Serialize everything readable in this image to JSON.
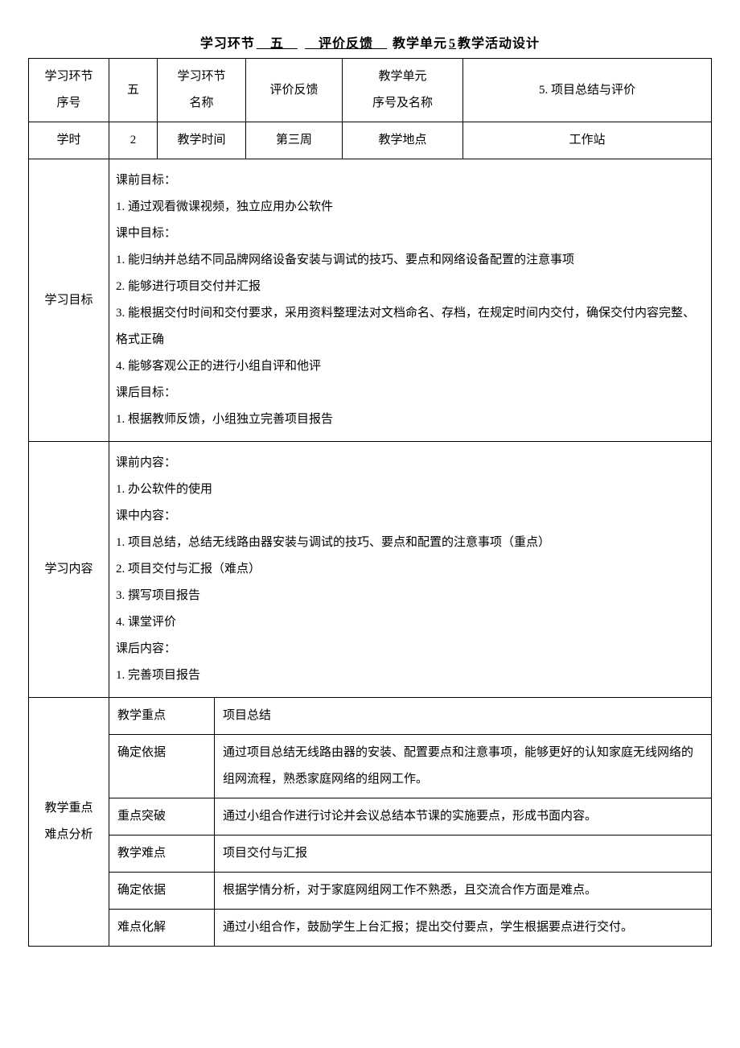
{
  "title": {
    "prefix": "学习环节",
    "seq_u": "五",
    "mid_u": "评价反馈",
    "unit_prefix": "教学单元",
    "unit_num": "5",
    "suffix": "教学活动设计"
  },
  "header": {
    "row1": {
      "c1": "学习环节\n序号",
      "c2": "五",
      "c3": "学习环节\n名称",
      "c4": "评价反馈",
      "c5": "教学单元\n序号及名称",
      "c6": "5. 项目总结与评价"
    },
    "row2": {
      "c1": "学时",
      "c2": "2",
      "c3": "教学时间",
      "c4": "第三周",
      "c5": "教学地点",
      "c6": "工作站"
    }
  },
  "goals": {
    "label": "学习目标",
    "lines": [
      "课前目标：",
      "1. 通过观看微课视频，独立应用办公软件",
      "课中目标：",
      "1. 能归纳并总结不同品牌网络设备安装与调试的技巧、要点和网络设备配置的注意事项",
      "2. 能够进行项目交付并汇报",
      "3. 能根据交付时间和交付要求，采用资料整理法对文档命名、存档，在规定时间内交付，确保交付内容完整、格式正确",
      "4. 能够客观公正的进行小组自评和他评",
      "课后目标：",
      "1. 根据教师反馈，小组独立完善项目报告"
    ]
  },
  "contents": {
    "label": "学习内容",
    "lines": [
      "课前内容：",
      "1. 办公软件的使用",
      "课中内容：",
      "1. 项目总结，总结无线路由器安装与调试的技巧、要点和配置的注意事项（重点）",
      "2. 项目交付与汇报（难点）",
      "3. 撰写项目报告",
      "4. 课堂评价",
      "课后内容：",
      "1. 完善项目报告"
    ]
  },
  "analysis": {
    "label": "教学重点\n难点分析",
    "rows": [
      {
        "k": "教学重点",
        "v": "项目总结"
      },
      {
        "k": "确定依据",
        "v": "通过项目总结无线路由器的安装、配置要点和注意事项，能够更好的认知家庭无线网络的组网流程，熟悉家庭网络的组网工作。"
      },
      {
        "k": "重点突破",
        "v": "通过小组合作进行讨论并会议总结本节课的实施要点，形成书面内容。"
      },
      {
        "k": "教学难点",
        "v": "项目交付与汇报"
      },
      {
        "k": "确定依据",
        "v": "根据学情分析，对于家庭网组网工作不熟悉，且交流合作方面是难点。"
      },
      {
        "k": "难点化解",
        "v": "通过小组合作，鼓励学生上台汇报；提出交付要点，学生根据要点进行交付。"
      }
    ]
  }
}
